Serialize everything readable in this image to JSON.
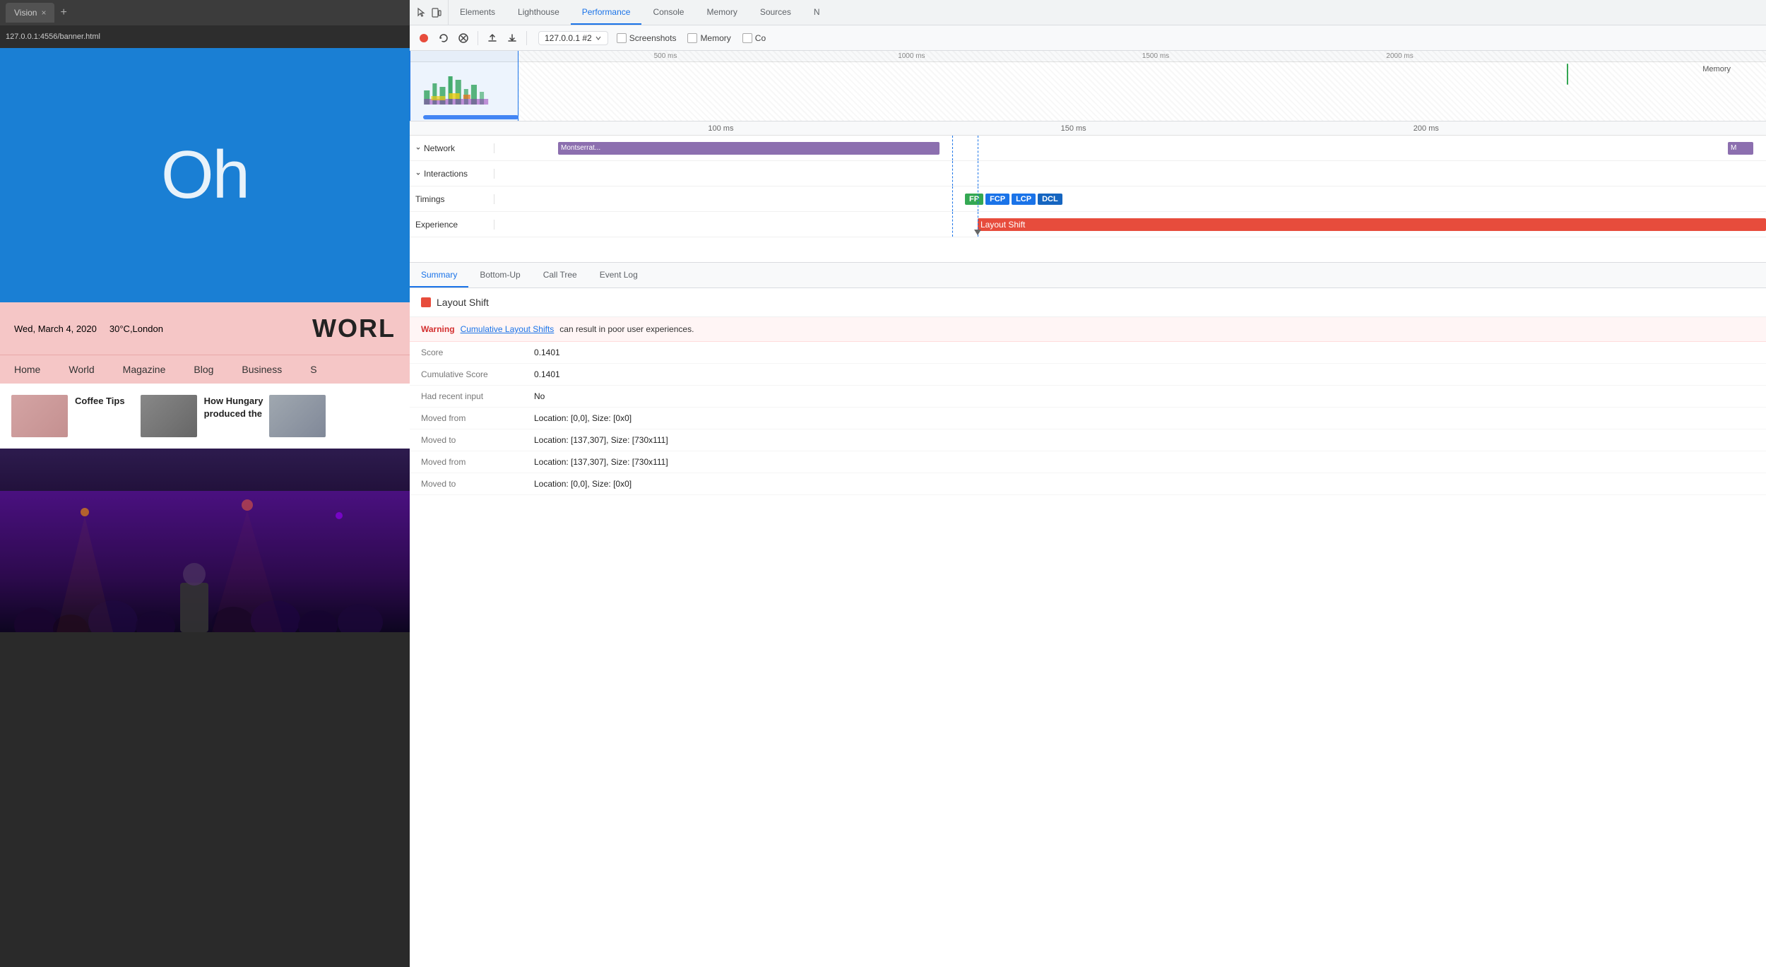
{
  "browser": {
    "tab_title": "Vision",
    "address": "127.0.0.1:4556/banner.html"
  },
  "webpage": {
    "hero_text": "Oh",
    "date": "Wed, March 4, 2020",
    "weather": "30°C,London",
    "news_title": "WORL",
    "nav_items": [
      "Home",
      "World",
      "Magazine",
      "Blog",
      "Business",
      "S"
    ],
    "cards": [
      {
        "text": "Coffee Tips"
      },
      {
        "text": "How Hungary produced the"
      }
    ]
  },
  "devtools": {
    "tabs": [
      {
        "label": "Elements",
        "active": false
      },
      {
        "label": "Lighthouse",
        "active": false
      },
      {
        "label": "Performance",
        "active": true
      },
      {
        "label": "Console",
        "active": false
      },
      {
        "label": "Memory",
        "active": false
      },
      {
        "label": "Sources",
        "active": false
      }
    ],
    "toolbar": {
      "profile_selector": "127.0.0.1 #2",
      "checkboxes": [
        "Screenshots",
        "Memory",
        "Co"
      ]
    },
    "timeline": {
      "overview_ticks": [
        "500 ms",
        "1000 ms",
        "1500 ms",
        "2000 ms"
      ],
      "detail_ticks": [
        "100 ms",
        "150 ms",
        "200 ms"
      ],
      "memory_label": "Memory"
    },
    "rows": [
      {
        "label": "Network",
        "bar_text": "Montserrat...",
        "bar2_text": "M"
      },
      {
        "label": "Interactions",
        "bar_text": ""
      },
      {
        "label": "Timings",
        "badges": [
          "FP",
          "FCP",
          "LCP",
          "DCL"
        ]
      },
      {
        "label": "Experience",
        "bar_text": "Layout Shift"
      }
    ],
    "analysis_tabs": [
      "Summary",
      "Bottom-Up",
      "Call Tree",
      "Event Log"
    ],
    "summary": {
      "header": "Layout Shift",
      "warning_label": "Warning",
      "warning_link": "Cumulative Layout Shifts",
      "warning_text": "can result in poor user experiences.",
      "score_label": "Score",
      "score_value": "0.1401",
      "cumulative_label": "Cumulative Score",
      "cumulative_value": "0.1401",
      "recent_input_label": "Had recent input",
      "recent_input_value": "No",
      "moved_from_1_label": "Moved from",
      "moved_from_1_value": "Location: [0,0], Size: [0x0]",
      "moved_to_1_label": "Moved to",
      "moved_to_1_value": "Location: [137,307], Size: [730x111]",
      "moved_from_2_label": "Moved from",
      "moved_from_2_value": "Location: [137,307], Size: [730x111]",
      "moved_to_2_label": "Moved to",
      "moved_to_2_value": "Location: [0,0], Size: [0x0]"
    }
  }
}
